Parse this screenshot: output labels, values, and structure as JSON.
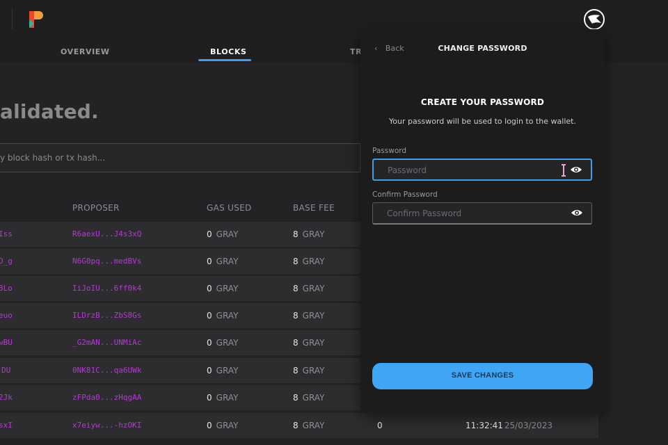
{
  "nav": {
    "tabs": [
      {
        "label": "OVERVIEW"
      },
      {
        "label": "BLOCKS"
      },
      {
        "label": "TRA"
      }
    ]
  },
  "main": {
    "heading": "alidated.",
    "search_placeholder": "y block hash or tx hash...",
    "columns": [
      "PROPOSER",
      "GAS USED",
      "BASE FEE"
    ],
    "rows": [
      {
        "hash": "Iss",
        "proposer": "R6aexU...J4s3xQ",
        "gas": "0",
        "gas_unit": "GRAY",
        "fee": "8",
        "fee_unit": "GRAY"
      },
      {
        "hash": "D_g",
        "proposer": "N6G0pq...medBVs",
        "gas": "0",
        "gas_unit": "GRAY",
        "fee": "8",
        "fee_unit": "GRAY"
      },
      {
        "hash": "3Lo",
        "proposer": "IiJoIU...6ff0k4",
        "gas": "0",
        "gas_unit": "GRAY",
        "fee": "8",
        "fee_unit": "GRAY"
      },
      {
        "hash": "euo",
        "proposer": "ILDrzB...ZbS8Gs",
        "gas": "0",
        "gas_unit": "GRAY",
        "fee": "8",
        "fee_unit": "GRAY"
      },
      {
        "hash": "wBU",
        "proposer": "_G2mAN...UNMiAc",
        "gas": "0",
        "gas_unit": "GRAY",
        "fee": "8",
        "fee_unit": "GRAY"
      },
      {
        "hash": "DU",
        "proposer": "0NK81C...qa6UWk",
        "gas": "0",
        "gas_unit": "GRAY",
        "fee": "8",
        "fee_unit": "GRAY"
      },
      {
        "hash": "2Jk",
        "proposer": "zFPda0...zHqgAA",
        "gas": "0",
        "gas_unit": "GRAY",
        "fee": "8",
        "fee_unit": "GRAY"
      },
      {
        "hash": "sxI",
        "proposer": "x7eiyw...-hzOKI",
        "gas": "0",
        "gas_unit": "GRAY",
        "fee": "8",
        "fee_unit": "GRAY",
        "extra": "0",
        "time": "11:32:41",
        "date": "25/03/2023"
      }
    ]
  },
  "modal": {
    "back_label": "Back",
    "title": "CHANGE PASSWORD",
    "create_title": "CREATE YOUR PASSWORD",
    "create_subtitle": "Your password will be used to login to the wallet.",
    "password_label": "Password",
    "password_placeholder": "Password",
    "confirm_label": "Confirm Password",
    "confirm_placeholder": "Confirm Password",
    "save_label": "SAVE CHANGES"
  },
  "colors": {
    "accent": "#3ea6f4",
    "hash_purple": "#b23bcf",
    "background": "#1a1a1b"
  },
  "icons": {
    "brand_logo": "brand-logo-icon",
    "user": "user-avatar-icon",
    "back": "chevron-left-icon",
    "eye": "eye-icon",
    "cursor": "text-cursor-icon"
  }
}
